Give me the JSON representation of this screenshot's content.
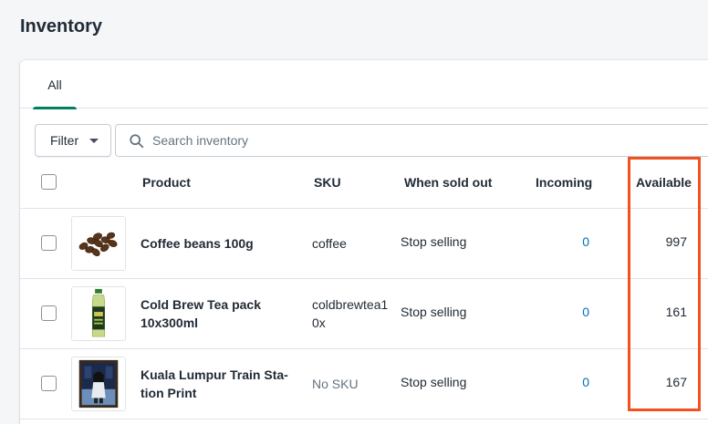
{
  "page": {
    "title": "Inventory"
  },
  "tabs": [
    {
      "label": "All",
      "active": true
    }
  ],
  "toolbar": {
    "filter_label": "Filter",
    "search_placeholder": "Search inventory",
    "search_value": ""
  },
  "table": {
    "columns": {
      "product": "Product",
      "sku": "SKU",
      "when_sold_out": "When sold out",
      "incoming": "Incoming",
      "available": "Available"
    },
    "rows": [
      {
        "product": "Coffee beans 100g",
        "sku": "coffee",
        "sku_missing": false,
        "when_sold_out": "Stop selling",
        "incoming": "0",
        "available": "997",
        "thumb": "coffee-beans-image"
      },
      {
        "product": "Cold Brew Tea pack 10x300ml",
        "sku": "coldbrewtea10x",
        "sku_missing": false,
        "when_sold_out": "Stop selling",
        "incoming": "0",
        "available": "161",
        "thumb": "tea-bottle-image"
      },
      {
        "product": "Kuala Lumpur Train Sta-tion Print",
        "sku": "No SKU",
        "sku_missing": true,
        "when_sold_out": "Stop selling",
        "incoming": "0",
        "available": "167",
        "thumb": "train-station-print-image"
      }
    ]
  },
  "colors": {
    "accent": "#008060",
    "link": "#006fbb",
    "highlight": "#f4511e"
  }
}
